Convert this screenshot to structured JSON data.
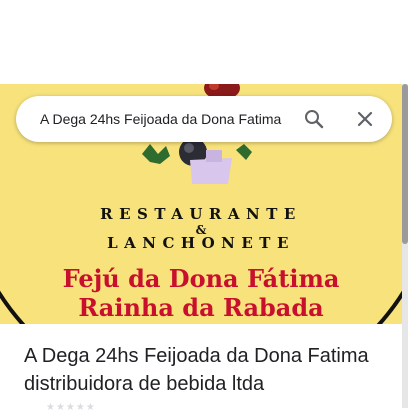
{
  "search": {
    "query": "A Dega 24hs Feijoada da Dona Fatima"
  },
  "place": {
    "title": "A Dega 24hs Feijoada da Dona Fatima distribuidora de bebida ltda"
  },
  "logo": {
    "restaurante": "RESTAURANTE",
    "ampersand": "&",
    "lanchonete": "LANCHONETE",
    "line1": "Fejú da Dona Fátima",
    "line2": "Rainha da Rabada"
  },
  "colors": {
    "hero_bg": "#f7e27b",
    "red_text": "#c8102e"
  },
  "icons": {
    "search": "search-icon",
    "close": "close-icon"
  }
}
